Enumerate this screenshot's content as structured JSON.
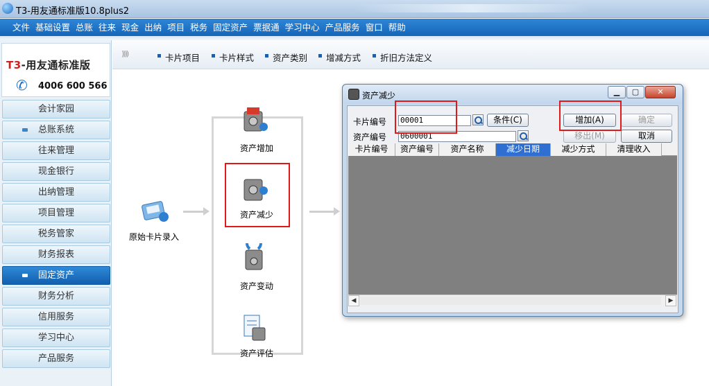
{
  "window": {
    "title": "T3-用友通标准版10.8plus2"
  },
  "menu": [
    "文件",
    "基础设置",
    "总账",
    "往来",
    "现金",
    "出纳",
    "项目",
    "税务",
    "固定资产",
    "票据通",
    "学习中心",
    "产品服务",
    "窗口",
    "帮助"
  ],
  "brand": {
    "name_prefix": "T3",
    "name_rest": "-用友通标准版",
    "phone": "4006 600 566",
    "phone_icon": "phone-icon"
  },
  "sidebar": {
    "items": [
      "会计家园",
      "总账系统",
      "往来管理",
      "现金银行",
      "出纳管理",
      "项目管理",
      "税务管家",
      "财务报表",
      "固定资产",
      "财务分析",
      "信用服务",
      "学习中心",
      "产品服务"
    ],
    "active_index": 8
  },
  "subnav": {
    "items": [
      "卡片项目",
      "卡片样式",
      "资产类别",
      "增减方式",
      "折旧方法定义"
    ]
  },
  "flow": {
    "source": "原始卡片录入",
    "items": [
      "资产增加",
      "资产减少",
      "资产变动",
      "资产评估"
    ]
  },
  "dialog": {
    "title": "资产减少",
    "card_label": "卡片编号",
    "card_value": "00001",
    "asset_label": "资产编号",
    "asset_value": "0600001",
    "condition_btn": "条件(C)",
    "add_btn": "增加(A)",
    "confirm_btn": "确定",
    "remove_btn": "移出(M)",
    "cancel_btn": "取消",
    "columns": [
      "卡片编号",
      "资产编号",
      "资产名称",
      "减少日期",
      "减少方式",
      "清理收入"
    ],
    "selected_column": 3
  },
  "colors": {
    "menubar": "#1565b8",
    "highlight": "#e01818",
    "selected_header": "#2f6fd2"
  }
}
